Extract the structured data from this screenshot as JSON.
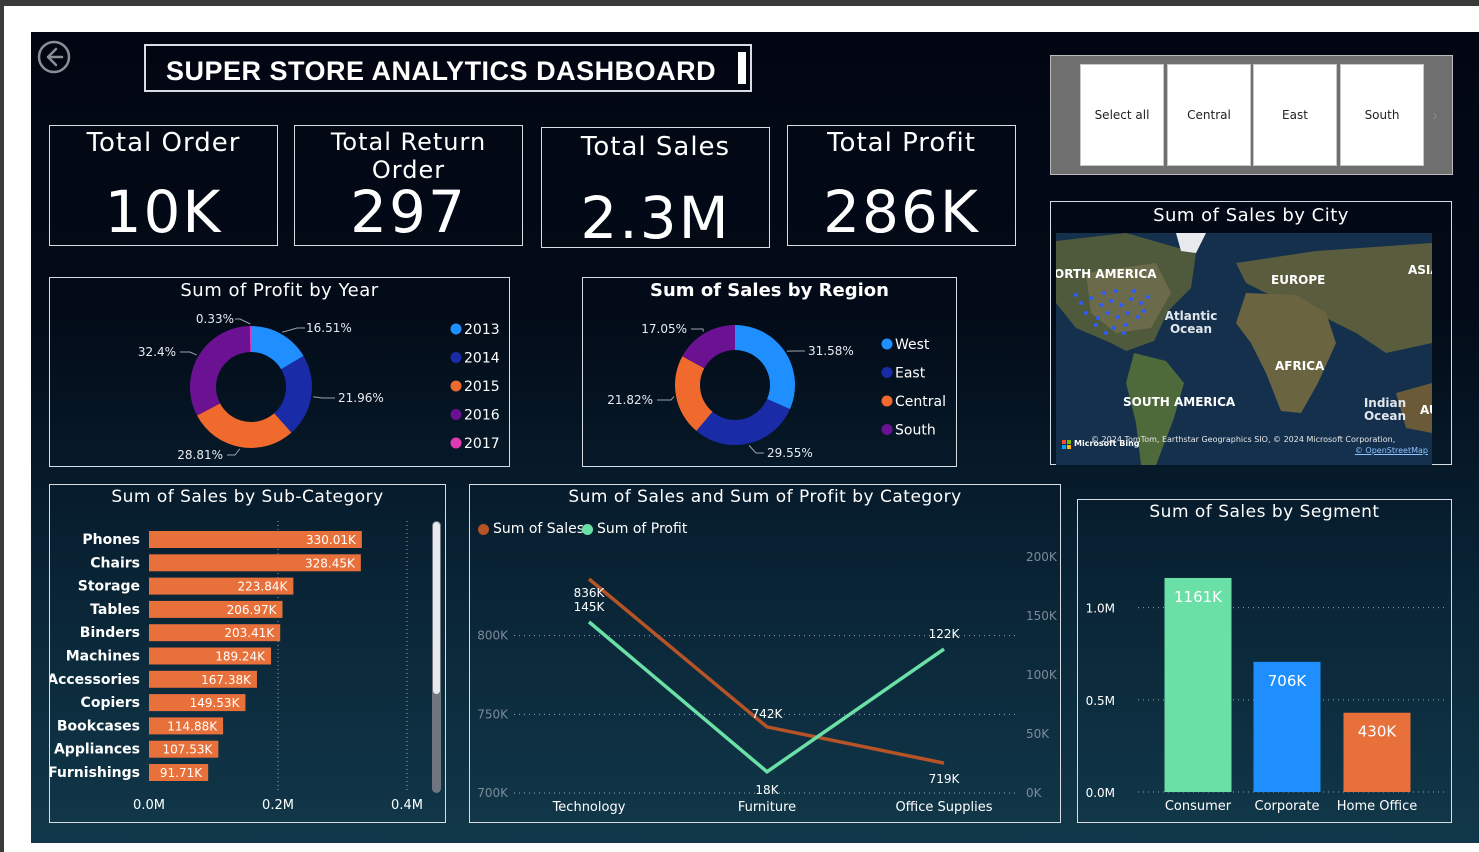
{
  "header": {
    "title": "SUPER STORE ANALYTICS DASHBOARD"
  },
  "kpis": [
    {
      "title": "Total Order",
      "value": "10K"
    },
    {
      "title": "Total Return Order",
      "value": "297"
    },
    {
      "title": "Total Sales",
      "value": "2.3M"
    },
    {
      "title": "Total Profit",
      "value": "286K"
    }
  ],
  "slicer": {
    "options": [
      "Select all",
      "Central",
      "East",
      "South"
    ]
  },
  "map": {
    "title": "Sum of Sales by City",
    "labels": {
      "north_america": "ORTH AMERICA",
      "europe": "EUROPE",
      "asia": "ASIA",
      "atlantic": "Atlantic Ocean",
      "africa": "AFRICA",
      "south_america": "SOUTH AMERICA",
      "indian": "Indian Ocean",
      "au": "AU"
    },
    "brand": "Microsoft Bing",
    "copyright": "© 2024 TomTom, Earthstar Geographics SIO, © 2024 Microsoft Corporation,",
    "osm": "© OpenStreetMap"
  },
  "colors": {
    "c2013": "#1f8fff",
    "c2014": "#1a2ba8",
    "c2015": "#f06a2e",
    "c2016": "#6a1291",
    "c2017": "#e23ab5",
    "bar": "#e8703a",
    "sales_line": "#b65327",
    "profit_line": "#6ae0a6",
    "consumer": "#6ae0a6",
    "corporate": "#1f8fff",
    "home_office": "#e8703a"
  },
  "chart_data": [
    {
      "type": "pie",
      "title": "Sum of Profit by Year",
      "legend": [
        "2013",
        "2014",
        "2015",
        "2016",
        "2017"
      ],
      "slices": [
        {
          "label": "2013",
          "value": 16.51,
          "text": "16.51%"
        },
        {
          "label": "2014",
          "value": 21.96,
          "text": "21.96%"
        },
        {
          "label": "2015",
          "value": 28.81,
          "text": "28.81%"
        },
        {
          "label": "2016",
          "value": 32.4,
          "text": "32.4%"
        },
        {
          "label": "2017",
          "value": 0.33,
          "text": "0.33%"
        }
      ]
    },
    {
      "type": "pie",
      "title": "Sum of Sales by Region",
      "legend": [
        "West",
        "East",
        "Central",
        "South"
      ],
      "slices": [
        {
          "label": "West",
          "value": 31.58,
          "text": "31.58%"
        },
        {
          "label": "East",
          "value": 29.55,
          "text": "29.55%"
        },
        {
          "label": "Central",
          "value": 21.82,
          "text": "21.82%"
        },
        {
          "label": "South",
          "value": 17.05,
          "text": "17.05%"
        }
      ]
    },
    {
      "type": "bar",
      "title": "Sum of Sales by Sub-Category",
      "categories": [
        "Phones",
        "Chairs",
        "Storage",
        "Tables",
        "Binders",
        "Machines",
        "Accessories",
        "Copiers",
        "Bookcases",
        "Appliances",
        "Furnishings"
      ],
      "values": [
        330.01,
        328.45,
        223.84,
        206.97,
        203.41,
        189.24,
        167.38,
        149.53,
        114.88,
        107.53,
        91.71
      ],
      "value_labels": [
        "330.01K",
        "328.45K",
        "223.84K",
        "206.97K",
        "203.41K",
        "189.24K",
        "167.38K",
        "149.53K",
        "114.88K",
        "107.53K",
        "91.71K"
      ],
      "xticks": [
        "0.0M",
        "0.2M",
        "0.4M"
      ],
      "xlim": [
        0,
        400
      ]
    },
    {
      "type": "line",
      "title": "Sum of Sales and Sum of Profit by Category",
      "categories": [
        "Technology",
        "Furniture",
        "Office Supplies"
      ],
      "series": [
        {
          "name": "Sum of Sales",
          "values": [
            836,
            742,
            719
          ],
          "labels": [
            "836K",
            "742K",
            "719K"
          ],
          "axis": "left"
        },
        {
          "name": "Sum of Profit",
          "values": [
            145,
            18,
            122
          ],
          "labels": [
            "145K",
            "18K",
            "122K"
          ],
          "axis": "right"
        }
      ],
      "yticks_left": [
        "700K",
        "750K",
        "800K"
      ],
      "ylim_left": [
        700,
        850
      ],
      "yticks_right": [
        "0K",
        "50K",
        "100K",
        "150K",
        "200K"
      ],
      "ylim_right": [
        0,
        200
      ]
    },
    {
      "type": "bar",
      "title": "Sum of Sales by Segment",
      "categories": [
        "Consumer",
        "Corporate",
        "Home Office"
      ],
      "values": [
        1161,
        706,
        430
      ],
      "value_labels": [
        "1161K",
        "706K",
        "430K"
      ],
      "yticks": [
        "0.0M",
        "0.5M",
        "1.0M"
      ],
      "ylim": [
        0,
        1150
      ]
    }
  ]
}
